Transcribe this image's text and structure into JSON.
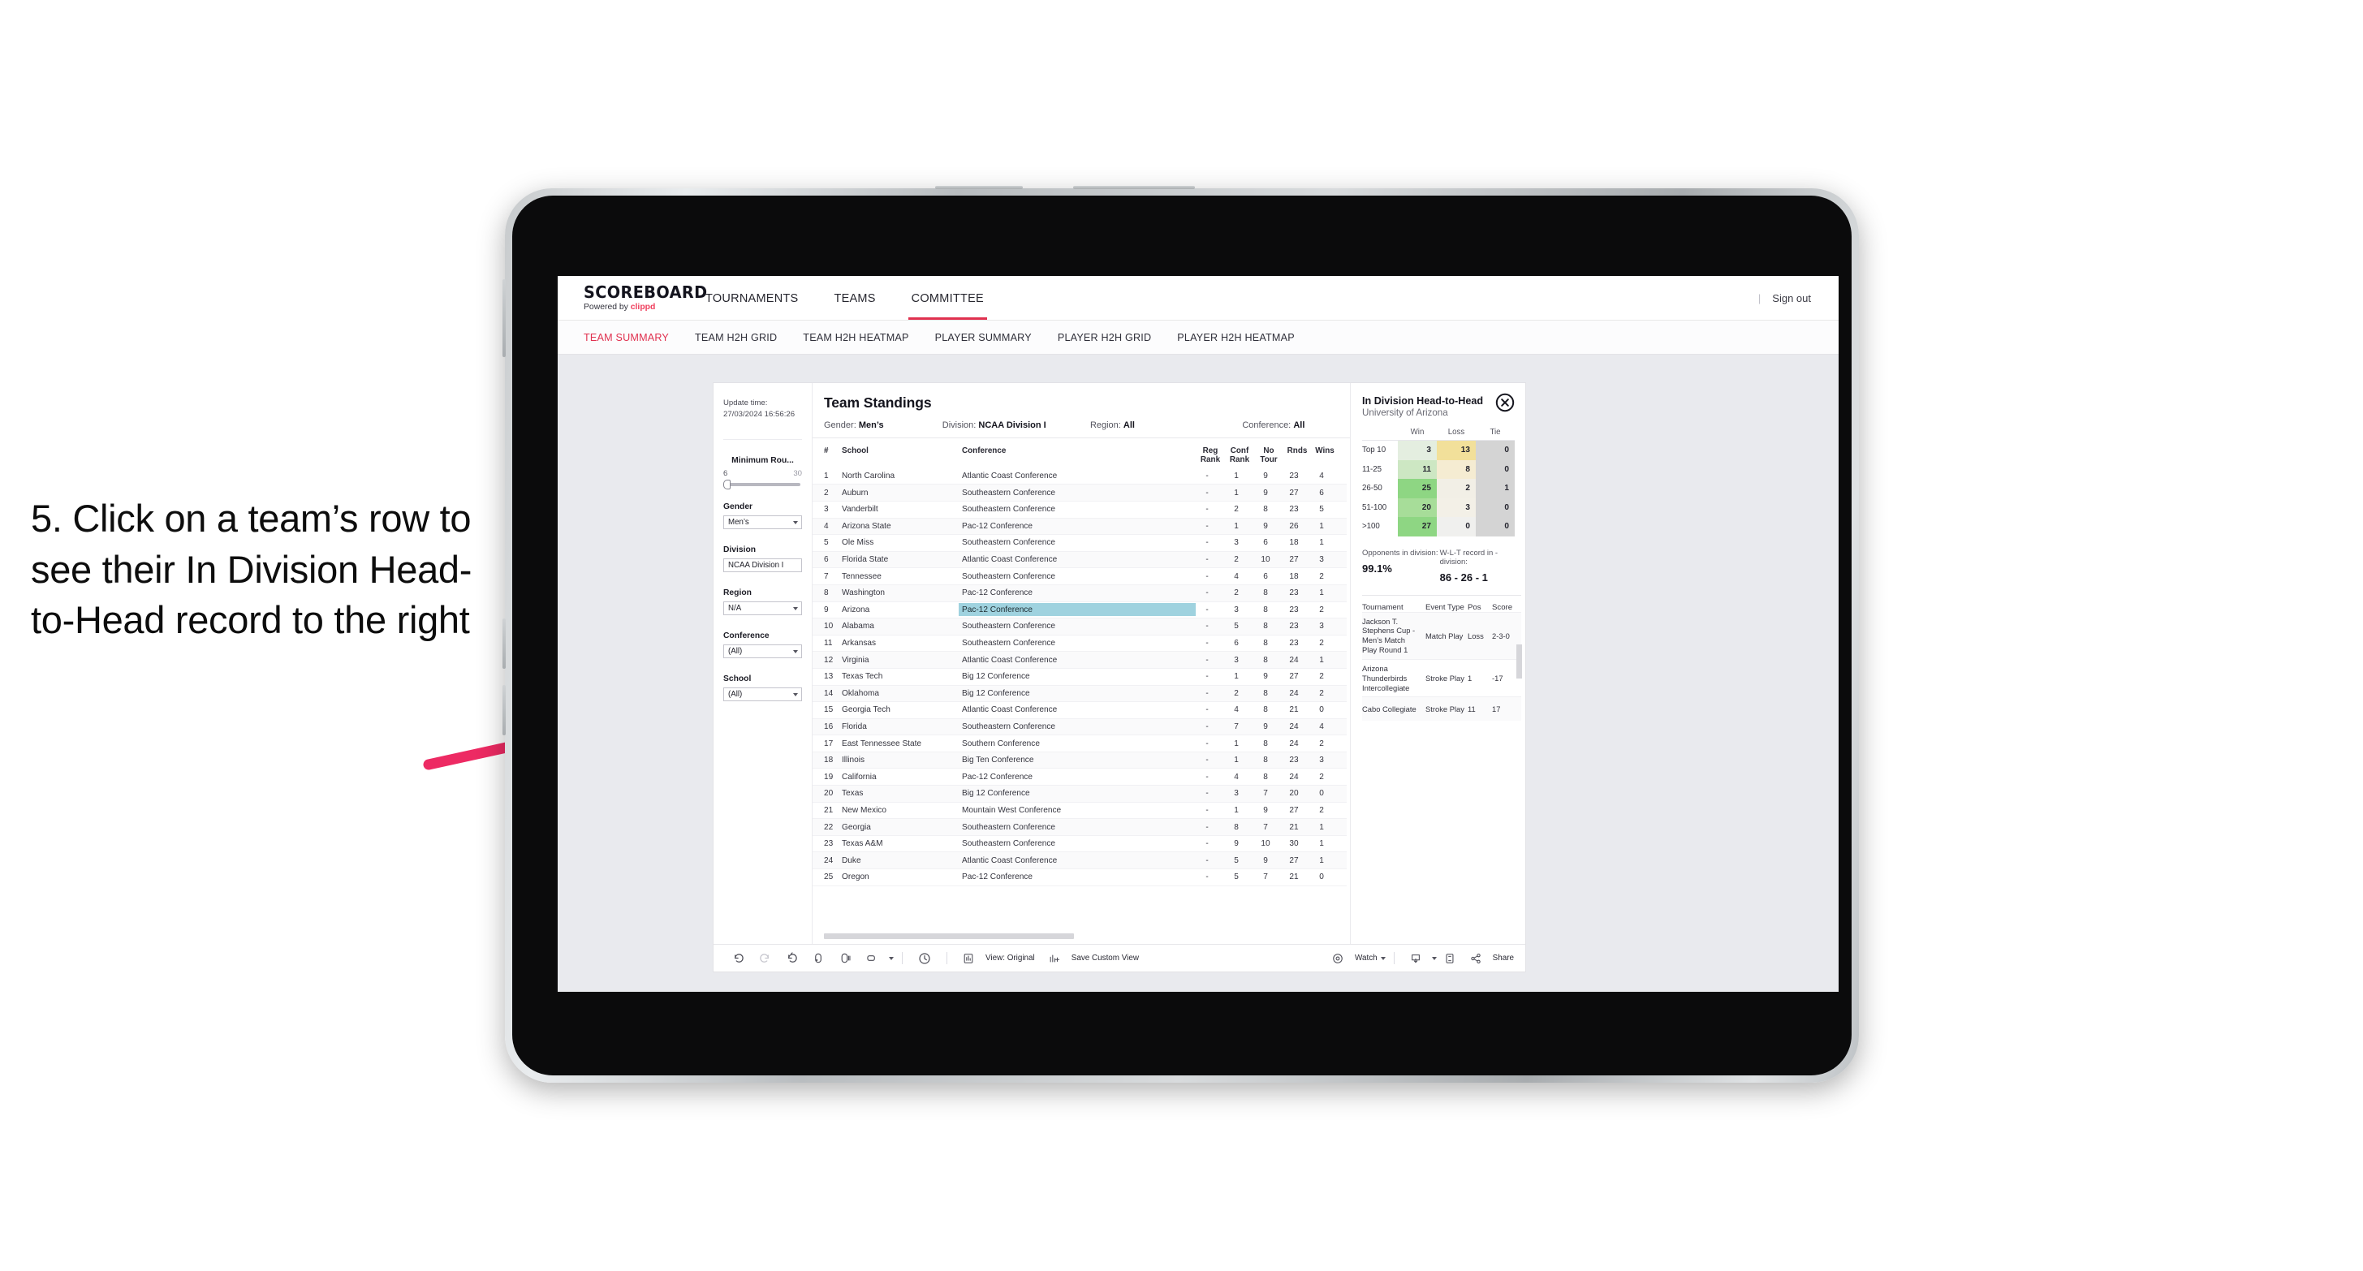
{
  "annotation": {
    "text": "5. Click on a team’s row to see their In Division Head-to-Head record to the right",
    "arrow_color": "#ed2a63"
  },
  "topnav": {
    "brand_title": "SCOREBOARD",
    "brand_sub_prefix": "Powered by ",
    "brand_sub_brand": "clippd",
    "items": [
      {
        "label": "TOURNAMENTS",
        "active": false
      },
      {
        "label": "TEAMS",
        "active": false
      },
      {
        "label": "COMMITTEE",
        "active": true
      }
    ],
    "separator": "|",
    "signout": "Sign out",
    "accent": "#e0314f"
  },
  "subtabs": [
    {
      "label": "TEAM SUMMARY",
      "active": true
    },
    {
      "label": "TEAM H2H GRID",
      "active": false
    },
    {
      "label": "TEAM H2H HEATMAP",
      "active": false
    },
    {
      "label": "PLAYER SUMMARY",
      "active": false
    },
    {
      "label": "PLAYER H2H GRID",
      "active": false
    },
    {
      "label": "PLAYER H2H HEATMAP",
      "active": false
    }
  ],
  "filters": {
    "update_time_label": "Update time:",
    "update_time_value": "27/03/2024 16:56:26",
    "slider": {
      "label": "Minimum Rou...",
      "min": "6",
      "max": "30"
    },
    "groups": [
      {
        "label": "Gender",
        "value": "Men’s"
      },
      {
        "label": "Division",
        "value": "NCAA Division I"
      },
      {
        "label": "Region",
        "value": "N/A"
      },
      {
        "label": "Conference",
        "value": "(All)"
      },
      {
        "label": "School",
        "value": "(All)"
      }
    ]
  },
  "standings": {
    "title": "Team Standings",
    "meta": [
      {
        "label": "Gender:",
        "value": "Men’s"
      },
      {
        "label": "Division:",
        "value": "NCAA Division I"
      },
      {
        "label": "Region:",
        "value": "All"
      },
      {
        "label": "Conference:",
        "value": "All"
      }
    ],
    "columns": {
      "rank": "#",
      "school": "School",
      "conference": "Conference",
      "reg_rank": "Reg Rank",
      "conf_rank": "Conf Rank",
      "no_tour": "No Tour",
      "rnds": "Rnds",
      "wins": "Wins"
    },
    "highlight_color": "#9fd2df",
    "selected_rank": 9,
    "rows": [
      {
        "rank": "1",
        "school": "North Carolina",
        "conference": "Atlantic Coast Conference",
        "reg_rank": "-",
        "conf_rank": "1",
        "no_tour": "9",
        "rnds": "23",
        "wins": "4"
      },
      {
        "rank": "2",
        "school": "Auburn",
        "conference": "Southeastern Conference",
        "reg_rank": "-",
        "conf_rank": "1",
        "no_tour": "9",
        "rnds": "27",
        "wins": "6"
      },
      {
        "rank": "3",
        "school": "Vanderbilt",
        "conference": "Southeastern Conference",
        "reg_rank": "-",
        "conf_rank": "2",
        "no_tour": "8",
        "rnds": "23",
        "wins": "5"
      },
      {
        "rank": "4",
        "school": "Arizona State",
        "conference": "Pac-12 Conference",
        "reg_rank": "-",
        "conf_rank": "1",
        "no_tour": "9",
        "rnds": "26",
        "wins": "1"
      },
      {
        "rank": "5",
        "school": "Ole Miss",
        "conference": "Southeastern Conference",
        "reg_rank": "-",
        "conf_rank": "3",
        "no_tour": "6",
        "rnds": "18",
        "wins": "1"
      },
      {
        "rank": "6",
        "school": "Florida State",
        "conference": "Atlantic Coast Conference",
        "reg_rank": "-",
        "conf_rank": "2",
        "no_tour": "10",
        "rnds": "27",
        "wins": "3"
      },
      {
        "rank": "7",
        "school": "Tennessee",
        "conference": "Southeastern Conference",
        "reg_rank": "-",
        "conf_rank": "4",
        "no_tour": "6",
        "rnds": "18",
        "wins": "2"
      },
      {
        "rank": "8",
        "school": "Washington",
        "conference": "Pac-12 Conference",
        "reg_rank": "-",
        "conf_rank": "2",
        "no_tour": "8",
        "rnds": "23",
        "wins": "1"
      },
      {
        "rank": "9",
        "school": "Arizona",
        "conference": "Pac-12 Conference",
        "reg_rank": "-",
        "conf_rank": "3",
        "no_tour": "8",
        "rnds": "23",
        "wins": "2"
      },
      {
        "rank": "10",
        "school": "Alabama",
        "conference": "Southeastern Conference",
        "reg_rank": "-",
        "conf_rank": "5",
        "no_tour": "8",
        "rnds": "23",
        "wins": "3"
      },
      {
        "rank": "11",
        "school": "Arkansas",
        "conference": "Southeastern Conference",
        "reg_rank": "-",
        "conf_rank": "6",
        "no_tour": "8",
        "rnds": "23",
        "wins": "2"
      },
      {
        "rank": "12",
        "school": "Virginia",
        "conference": "Atlantic Coast Conference",
        "reg_rank": "-",
        "conf_rank": "3",
        "no_tour": "8",
        "rnds": "24",
        "wins": "1"
      },
      {
        "rank": "13",
        "school": "Texas Tech",
        "conference": "Big 12 Conference",
        "reg_rank": "-",
        "conf_rank": "1",
        "no_tour": "9",
        "rnds": "27",
        "wins": "2"
      },
      {
        "rank": "14",
        "school": "Oklahoma",
        "conference": "Big 12 Conference",
        "reg_rank": "-",
        "conf_rank": "2",
        "no_tour": "8",
        "rnds": "24",
        "wins": "2"
      },
      {
        "rank": "15",
        "school": "Georgia Tech",
        "conference": "Atlantic Coast Conference",
        "reg_rank": "-",
        "conf_rank": "4",
        "no_tour": "8",
        "rnds": "21",
        "wins": "0"
      },
      {
        "rank": "16",
        "school": "Florida",
        "conference": "Southeastern Conference",
        "reg_rank": "-",
        "conf_rank": "7",
        "no_tour": "9",
        "rnds": "24",
        "wins": "4"
      },
      {
        "rank": "17",
        "school": "East Tennessee State",
        "conference": "Southern Conference",
        "reg_rank": "-",
        "conf_rank": "1",
        "no_tour": "8",
        "rnds": "24",
        "wins": "2"
      },
      {
        "rank": "18",
        "school": "Illinois",
        "conference": "Big Ten Conference",
        "reg_rank": "-",
        "conf_rank": "1",
        "no_tour": "8",
        "rnds": "23",
        "wins": "3"
      },
      {
        "rank": "19",
        "school": "California",
        "conference": "Pac-12 Conference",
        "reg_rank": "-",
        "conf_rank": "4",
        "no_tour": "8",
        "rnds": "24",
        "wins": "2"
      },
      {
        "rank": "20",
        "school": "Texas",
        "conference": "Big 12 Conference",
        "reg_rank": "-",
        "conf_rank": "3",
        "no_tour": "7",
        "rnds": "20",
        "wins": "0"
      },
      {
        "rank": "21",
        "school": "New Mexico",
        "conference": "Mountain West Conference",
        "reg_rank": "-",
        "conf_rank": "1",
        "no_tour": "9",
        "rnds": "27",
        "wins": "2"
      },
      {
        "rank": "22",
        "school": "Georgia",
        "conference": "Southeastern Conference",
        "reg_rank": "-",
        "conf_rank": "8",
        "no_tour": "7",
        "rnds": "21",
        "wins": "1"
      },
      {
        "rank": "23",
        "school": "Texas A&M",
        "conference": "Southeastern Conference",
        "reg_rank": "-",
        "conf_rank": "9",
        "no_tour": "10",
        "rnds": "30",
        "wins": "1"
      },
      {
        "rank": "24",
        "school": "Duke",
        "conference": "Atlantic Coast Conference",
        "reg_rank": "-",
        "conf_rank": "5",
        "no_tour": "9",
        "rnds": "27",
        "wins": "1"
      },
      {
        "rank": "25",
        "school": "Oregon",
        "conference": "Pac-12 Conference",
        "reg_rank": "-",
        "conf_rank": "5",
        "no_tour": "7",
        "rnds": "21",
        "wins": "0"
      }
    ]
  },
  "h2h": {
    "title": "In Division Head-to-Head",
    "subtitle": "University of Arizona",
    "close_icon": "close-circle-icon",
    "matrix": {
      "columns": [
        "Win",
        "Loss",
        "Tie"
      ],
      "rows": [
        {
          "label": "Top 10",
          "win": "3",
          "loss": "13",
          "tie": "0",
          "win_color": "#e4eee0",
          "loss_color": "#f2e09a",
          "tie_color": "#d4d4d4"
        },
        {
          "label": "11-25",
          "win": "11",
          "loss": "8",
          "tie": "0",
          "win_color": "#cde7c3",
          "loss_color": "#f5ecd2",
          "tie_color": "#d4d4d4"
        },
        {
          "label": "26-50",
          "win": "25",
          "loss": "2",
          "tie": "1",
          "win_color": "#8ed683",
          "loss_color": "#f2efe6",
          "tie_color": "#d4d4d4"
        },
        {
          "label": "51-100",
          "win": "20",
          "loss": "3",
          "tie": "0",
          "win_color": "#a7dd99",
          "loss_color": "#f3f0e7",
          "tie_color": "#d4d4d4"
        },
        {
          "label": ">100",
          "win": "27",
          "loss": "0",
          "tie": "0",
          "win_color": "#8ed683",
          "loss_color": "#f0f0ee",
          "tie_color": "#d4d4d4"
        }
      ]
    },
    "stats": [
      {
        "label": "Opponents in division:",
        "value": "99.1%"
      },
      {
        "label": "W-L-T record in -division:",
        "value": "86 - 26 - 1"
      }
    ],
    "tournaments": {
      "columns": {
        "name": "Tournament",
        "type": "Event Type",
        "pos": "Pos",
        "score": "Score"
      },
      "rows": [
        {
          "name": "Jackson T. Stephens Cup - Men’s Match Play Round 1",
          "type": "Match Play",
          "pos": "Loss",
          "score": "2-3-0"
        },
        {
          "name": "Arizona Thunderbirds Intercollegiate",
          "type": "Stroke Play",
          "pos": "1",
          "score": "-17"
        },
        {
          "name": "Cabo Collegiate",
          "type": "Stroke Play",
          "pos": "11",
          "score": "17"
        }
      ]
    }
  },
  "toolbar": {
    "undo": "undo-icon",
    "redo": "redo-icon",
    "revert": "revert-icon",
    "refresh": "refresh-icon",
    "pause": "pause-auto-update-icon",
    "dropdown": "view-options-icon",
    "alert": "alerts-icon",
    "view_label": "View: Original",
    "save_label": "Save Custom View",
    "watch_label": "Watch",
    "download": "download-icon",
    "fullscreen": "fullscreen-icon",
    "share_label": "Share"
  }
}
